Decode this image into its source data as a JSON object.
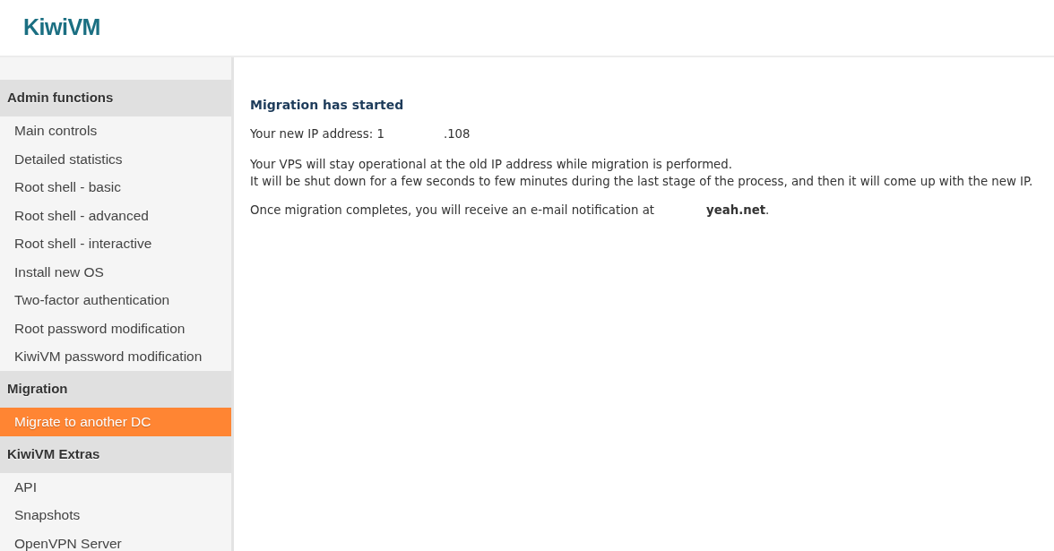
{
  "header": {
    "logo": "KiwiVM"
  },
  "sidebar": {
    "sections": [
      {
        "title": "Admin functions",
        "items": [
          {
            "label": "Main controls",
            "selected": false
          },
          {
            "label": "Detailed statistics",
            "selected": false
          },
          {
            "label": "Root shell - basic",
            "selected": false
          },
          {
            "label": "Root shell - advanced",
            "selected": false
          },
          {
            "label": "Root shell - interactive",
            "selected": false
          },
          {
            "label": "Install new OS",
            "selected": false
          },
          {
            "label": "Two-factor authentication",
            "selected": false
          },
          {
            "label": "Root password modification",
            "selected": false
          },
          {
            "label": "KiwiVM password modification",
            "selected": false
          }
        ]
      },
      {
        "title": "Migration",
        "items": [
          {
            "label": "Migrate to another DC",
            "selected": true
          }
        ]
      },
      {
        "title": "KiwiVM Extras",
        "items": [
          {
            "label": "API",
            "selected": false
          },
          {
            "label": "Snapshots",
            "selected": false
          },
          {
            "label": "OpenVPN Server",
            "selected": false
          }
        ]
      }
    ]
  },
  "content": {
    "title": "Migration has started",
    "ip_label": "Your new IP address: 1",
    "ip_suffix": ".108",
    "paragraph_lines": [
      "Your VPS will stay operational at the old IP address while migration is performed.",
      "It will be shut down for a few seconds to few minutes during the last stage of the process, and then it will come up with the new IP."
    ],
    "notification_text": "Once migration completes, you will receive an e-mail notification at",
    "email_domain": "yeah.net",
    "notification_end": "."
  }
}
